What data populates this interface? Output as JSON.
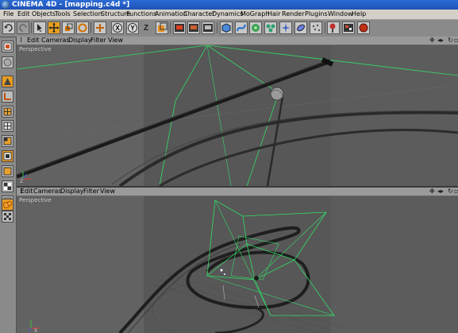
{
  "window": {
    "app_name": "CINEMA 4D",
    "document": "[mapping.c4d *]"
  },
  "menu": [
    "File",
    "Edit",
    "Objects",
    "Tools",
    "Selection",
    "Structure",
    "Functions",
    "Animation",
    "Character",
    "Dynamics",
    "MoGraph",
    "Hair",
    "Render",
    "Plugins",
    "Window",
    "Help"
  ],
  "toolbar_icons": [
    "undo-icon",
    "redo-icon",
    "live-selection-icon",
    "move-icon",
    "scale-icon",
    "rotate-icon",
    "model-mode-icon",
    "x-axis-icon",
    "y-axis-icon",
    "z-axis-icon",
    "coordinate-system-icon",
    "render-view-icon",
    "render-picture-viewer-icon",
    "render-settings-icon",
    "cube-icon",
    "spline-pen-icon",
    "nurbs-icon",
    "array-icon",
    "deformer-icon",
    "scene-icon",
    "camera-icon",
    "light-icon",
    "particle-icon",
    "material-icon"
  ],
  "sidebar_icons": [
    "make-editable-icon",
    "object-mode-icon",
    "points-mode-icon",
    "edges-mode-icon",
    "polygons-mode-icon",
    "axis-icon",
    "texture-icon",
    "animation-mode-icon",
    "workplane-icon",
    "texture-axis-icon",
    "paint-icon",
    "checkerboard-icon",
    "grid-icon",
    "sculpt-icon"
  ],
  "viewports": [
    {
      "menu": [
        "Edit",
        "Cameras",
        "Display",
        "Filter",
        "View"
      ],
      "label": "Perspective"
    },
    {
      "menu": [
        "Edit",
        "Cameras",
        "Display",
        "Filter",
        "View"
      ],
      "label": "Perspective"
    }
  ],
  "axis_labels": {
    "x": "X",
    "y": "Y",
    "z": "Z"
  },
  "colors": {
    "guide_green": "#33dd66",
    "viewport_bg": "#5e5e5e"
  }
}
